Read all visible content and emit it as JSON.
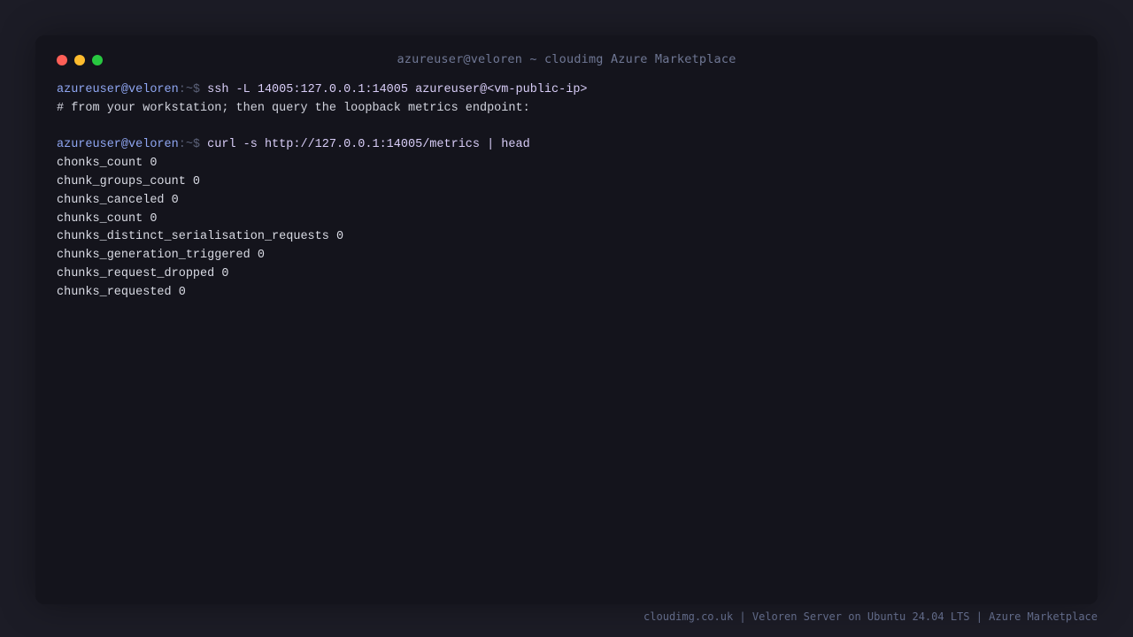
{
  "window": {
    "title": "azureuser@veloren ~ cloudimg Azure Marketplace"
  },
  "terminal": {
    "prompt_user": "azureuser@veloren",
    "prompt_path": ":~$",
    "lines": [
      {
        "kind": "command",
        "text": "ssh -L 14005:127.0.0.1:14005 azureuser@<vm-public-ip>"
      },
      {
        "kind": "comment",
        "text": "# from your workstation; then query the loopback metrics endpoint:"
      },
      {
        "kind": "blank",
        "text": ""
      },
      {
        "kind": "command",
        "text": "curl -s http://127.0.0.1:14005/metrics | head"
      },
      {
        "kind": "output",
        "text": "chonks_count 0"
      },
      {
        "kind": "output",
        "text": "chunk_groups_count 0"
      },
      {
        "kind": "output",
        "text": "chunks_canceled 0"
      },
      {
        "kind": "output",
        "text": "chunks_count 0"
      },
      {
        "kind": "output",
        "text": "chunks_distinct_serialisation_requests 0"
      },
      {
        "kind": "output",
        "text": "chunks_generation_triggered 0"
      },
      {
        "kind": "output",
        "text": "chunks_request_dropped 0"
      },
      {
        "kind": "output",
        "text": "chunks_requested 0"
      }
    ]
  },
  "footer": {
    "text": "cloudimg.co.uk | Veloren Server on Ubuntu 24.04 LTS | Azure Marketplace"
  },
  "colors": {
    "background": "#1c1c26",
    "window": "#14141c",
    "prompt_user": "#8fa6f2",
    "command": "#d8cdf7",
    "close_dot": "#ff5f57",
    "minimize_dot": "#febc2e",
    "maximize_dot": "#28c840"
  }
}
